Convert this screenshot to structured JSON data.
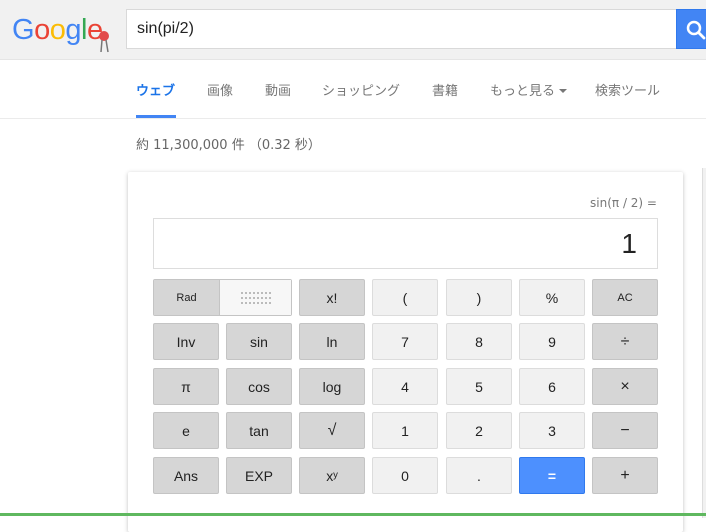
{
  "header": {
    "logo_text": "Google",
    "search_value": "sin(pi/2)",
    "colors": {
      "accent": "#4285f4",
      "logo_blue": "#4285f4",
      "logo_red": "#ea4335",
      "logo_yellow": "#fbbc05",
      "logo_green": "#34a853"
    }
  },
  "tabs": [
    {
      "label": "ウェブ",
      "active": true
    },
    {
      "label": "画像"
    },
    {
      "label": "動画"
    },
    {
      "label": "ショッピング"
    },
    {
      "label": "書籍"
    },
    {
      "label": "もっと見る"
    },
    {
      "label": "検索ツール"
    }
  ],
  "result_stats": "約 11,300,000 件 （0.32 秒）",
  "calculator": {
    "equation": "sin(π / 2) =",
    "result": "1",
    "mode_rad": "Rad",
    "mode_deg": "Deg",
    "keys": {
      "fact": "x!",
      "lparen": "(",
      "rparen": ")",
      "percent": "%",
      "ac": "AC",
      "inv": "Inv",
      "sin": "sin",
      "ln": "ln",
      "seven": "7",
      "eight": "8",
      "nine": "9",
      "divide": "÷",
      "pi": "π",
      "cos": "cos",
      "log": "log",
      "four": "4",
      "five": "5",
      "six": "6",
      "multiply": "×",
      "e": "e",
      "tan": "tan",
      "sqrt": "√",
      "one": "1",
      "two": "2",
      "three": "3",
      "minus": "−",
      "ans": "Ans",
      "exp": "EXP",
      "pow": "xʸ",
      "zero": "0",
      "dot": ".",
      "equals": "=",
      "plus": "+"
    }
  }
}
